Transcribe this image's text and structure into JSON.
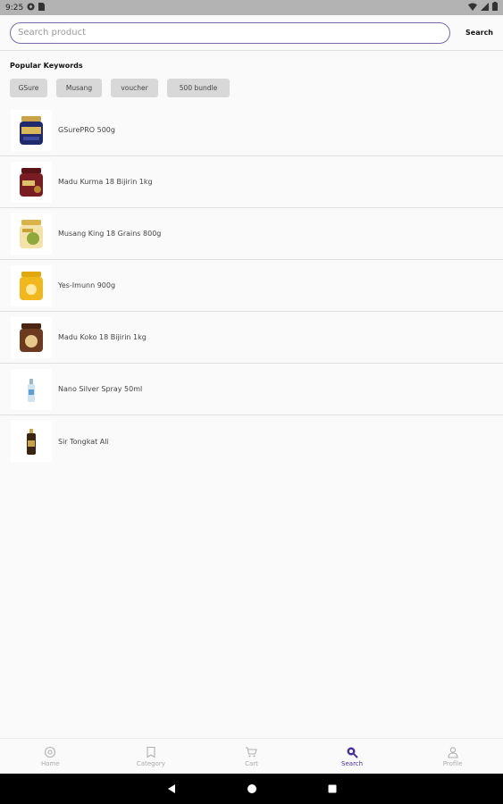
{
  "status_bar": {
    "time": "9:25"
  },
  "search": {
    "placeholder": "Search product",
    "value": "",
    "button_label": "Search"
  },
  "keywords": {
    "title": "Popular Keywords",
    "items": [
      "GSure",
      "Musang",
      "voucher",
      "500 bundle"
    ]
  },
  "products": [
    {
      "name": "GSurePRO 500g",
      "icon": "jar-navy-gold",
      "color": "#1f2a6b"
    },
    {
      "name": "Madu Kurma 18 Bijirin 1kg",
      "icon": "jar-maroon",
      "color": "#7a1d22"
    },
    {
      "name": "Musang King 18 Grains 800g",
      "icon": "jar-gold-green",
      "color": "#d9b34a"
    },
    {
      "name": "Yes-Imunn 900g",
      "icon": "jar-yellow",
      "color": "#f0b81d"
    },
    {
      "name": "Madu Koko 18 Bijirin 1kg",
      "icon": "jar-brown",
      "color": "#6b3a1f"
    },
    {
      "name": "Nano Silver Spray 50ml",
      "icon": "spray-bottle",
      "color": "#cfe3f0"
    },
    {
      "name": "Sir Tongkat Ali",
      "icon": "amber-bottle",
      "color": "#3a2412"
    }
  ],
  "bottom_nav": [
    {
      "label": "Home",
      "icon": "home-icon",
      "active": false
    },
    {
      "label": "Category",
      "icon": "category-icon",
      "active": false
    },
    {
      "label": "Cart",
      "icon": "cart-icon",
      "active": false
    },
    {
      "label": "Search",
      "icon": "search-icon",
      "active": true
    },
    {
      "label": "Profile",
      "icon": "profile-icon",
      "active": false
    }
  ],
  "colors": {
    "accent": "#4a2fa0",
    "search_border": "#7a6aa8",
    "chip_bg": "#d8d8d8"
  }
}
